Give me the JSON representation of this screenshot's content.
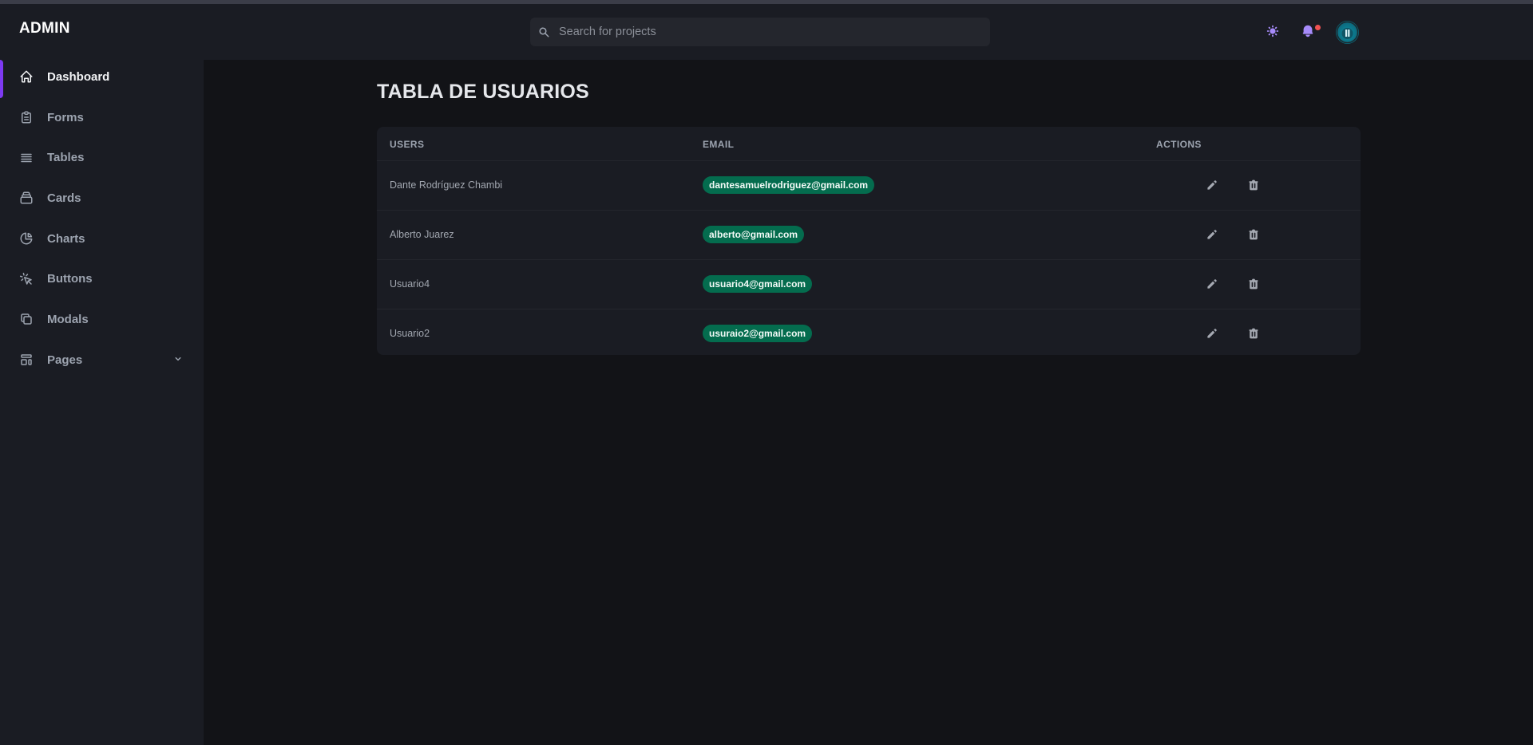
{
  "brand": "ADMIN",
  "accent_color": "#7e3af2",
  "badge_color": "#046c4e",
  "sidebar": {
    "items": [
      {
        "label": "Dashboard",
        "icon": "home-icon",
        "active": true
      },
      {
        "label": "Forms",
        "icon": "clipboard-icon"
      },
      {
        "label": "Tables",
        "icon": "list-icon"
      },
      {
        "label": "Cards",
        "icon": "cards-icon"
      },
      {
        "label": "Charts",
        "icon": "pie-chart-icon"
      },
      {
        "label": "Buttons",
        "icon": "cursor-click-icon"
      },
      {
        "label": "Modals",
        "icon": "duplicate-icon"
      },
      {
        "label": "Pages",
        "icon": "template-icon",
        "has_dropdown": true
      }
    ]
  },
  "header": {
    "search_placeholder": "Search for projects",
    "icons": [
      "sun-icon",
      "bell-icon",
      "avatar"
    ]
  },
  "main": {
    "title": "TABLA DE USUARIOS",
    "table": {
      "columns": [
        "USERS",
        "EMAIL",
        "ACTIONS"
      ],
      "rows": [
        {
          "user": "Dante Rodríguez Chambi",
          "email": "dantesamuelrodriguez@gmail.com"
        },
        {
          "user": "Alberto Juarez",
          "email": "alberto@gmail.com"
        },
        {
          "user": "Usuario4",
          "email": "usuario4@gmail.com"
        },
        {
          "user": "Usuario2",
          "email": "usuraio2@gmail.com"
        }
      ],
      "actions": [
        "edit-icon",
        "trash-icon"
      ]
    }
  }
}
